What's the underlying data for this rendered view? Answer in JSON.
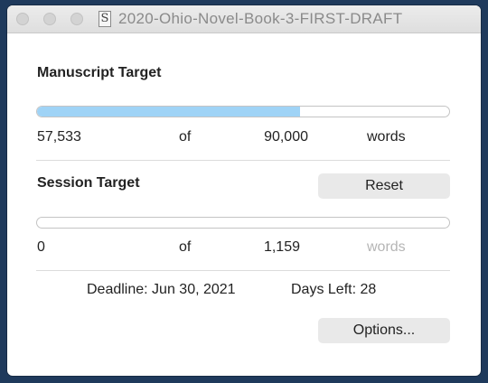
{
  "window": {
    "title": "2020-Ohio-Novel-Book-3-FIRST-DRAFT",
    "document_icon_glyph": "S"
  },
  "manuscript": {
    "heading": "Manuscript Target",
    "current": "57,533",
    "of_label": "of",
    "target": "90,000",
    "unit": "words",
    "progress_fraction": 0.639
  },
  "session": {
    "heading": "Session Target",
    "reset_label": "Reset",
    "current": "0",
    "of_label": "of",
    "target": "1,159",
    "unit": "words",
    "progress_fraction": 0.0
  },
  "footer": {
    "deadline_text": "Deadline: Jun 30, 2021",
    "days_left_text": "Days Left: 28",
    "options_label": "Options..."
  },
  "colors": {
    "progress_fill": "#9fd3f6",
    "desktop_background": "#1f3a5c"
  }
}
